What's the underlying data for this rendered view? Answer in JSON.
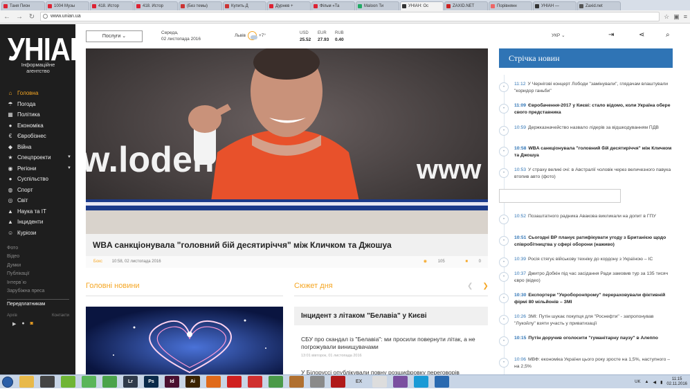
{
  "browser": {
    "tabs": [
      {
        "label": "Таня Пион",
        "color": "#d23"
      },
      {
        "label": "1004 Музы",
        "color": "#d23"
      },
      {
        "label": "418. Истор",
        "color": "#d23"
      },
      {
        "label": "418. Истор",
        "color": "#d23"
      },
      {
        "label": "(Без темы)",
        "color": "#c33"
      },
      {
        "label": "Купить Д",
        "color": "#c33"
      },
      {
        "label": "Дурнев +",
        "color": "#d23"
      },
      {
        "label": "Фільм «Та",
        "color": "#d23"
      },
      {
        "label": "Maloon Ти",
        "color": "#2a6"
      },
      {
        "label": "УНІАН: Ос",
        "color": "#333",
        "active": true
      },
      {
        "label": "ZAXID.NET",
        "color": "#c22"
      },
      {
        "label": "Порівнянн",
        "color": "#e66"
      },
      {
        "label": "УНІАН — ",
        "color": "#333"
      },
      {
        "label": "Zaxid.net",
        "color": "#555"
      }
    ],
    "url": "www.unian.ua"
  },
  "sidebar": {
    "logo": "УНІАН",
    "logo_sub1": "Інформаційне",
    "logo_sub2": "агентство",
    "menu": [
      {
        "label": "Головна",
        "icon": "home-icon",
        "glyph": "⌂",
        "active": true
      },
      {
        "label": "Погода",
        "icon": "umbrella-icon",
        "glyph": "☂"
      },
      {
        "label": "Політика",
        "icon": "building-icon",
        "glyph": "▦"
      },
      {
        "label": "Економіка",
        "icon": "coin-icon",
        "glyph": "●"
      },
      {
        "label": "Євробізнес",
        "icon": "euro-icon",
        "glyph": "€"
      },
      {
        "label": "Війна",
        "icon": "shield-icon",
        "glyph": "◆"
      },
      {
        "label": "Спецпроекти",
        "icon": "star-icon",
        "glyph": "★",
        "caret": true
      },
      {
        "label": "Регіони",
        "icon": "globe-icon",
        "glyph": "◉",
        "caret": true
      },
      {
        "label": "Суспільство",
        "icon": "people-icon",
        "glyph": "●"
      },
      {
        "label": "Спорт",
        "icon": "ball-icon",
        "glyph": "◍"
      },
      {
        "label": "Світ",
        "icon": "world-icon",
        "glyph": "◎"
      },
      {
        "label": "Наука та IT",
        "icon": "flask-icon",
        "glyph": "▲"
      },
      {
        "label": "Інциденти",
        "icon": "warning-icon",
        "glyph": "▲"
      },
      {
        "label": "Куріози",
        "icon": "smile-icon",
        "glyph": "☺"
      }
    ],
    "submenu": [
      "Фото",
      "Відео",
      "Думки",
      "Публікації",
      "Інтерв`ю",
      "Зарубіжна преса"
    ],
    "subscribers": "Передплатникам",
    "archive": "Архів",
    "contacts": "Контакти"
  },
  "topbar": {
    "services": "Послуги",
    "date_line1": "Середа,",
    "date_line2": "02 листопада 2016",
    "city": "Львів",
    "temp": "+7°",
    "currencies": [
      {
        "code": "USD",
        "value": "25.52"
      },
      {
        "code": "EUR",
        "value": "27.93"
      },
      {
        "code": "RUB",
        "value": "0.40"
      }
    ],
    "lang": "УКР"
  },
  "hero": {
    "title": "WBA санкціонувала \"головний бій десятиріччя\" між Кличком та Джошуа",
    "category": "Бокс",
    "datetime": "10:58, 02 листопада 2016",
    "views": "105",
    "comments": "0",
    "banner_text": "w.loden",
    "banner_text2": "www"
  },
  "sections": {
    "main_news": "Головні новини",
    "story": "Сюжет дня"
  },
  "story": {
    "title": "Інцидент з літаком \"Белавіа\" у Києві",
    "item1": "СБУ про скандал із \"Белавіа\": ми просили повернути літак, а не погрожували винищувачами",
    "item1_date": "13:01 вівторок, 01 листопада 2016",
    "item2": "У Білоруссі опублікували повну розшифровку переговорів"
  },
  "feed": {
    "title": "Стрічка новин",
    "items": [
      {
        "time": "11:12",
        "text": "У Чернігові концерт Лободи \"замінували\", глядачам влаштували \"коридор ганьби\"",
        "bold": false,
        "icon": "photo-icon"
      },
      {
        "time": "11:09",
        "text": "Євробачення-2017 у Києві: стало відомо, коли Україна обере свого представника",
        "bold": true,
        "icon": "news-icon"
      },
      {
        "time": "10:59",
        "text": "Держказначейство назвало лідерів за відшкодуванням ПДВ",
        "bold": false,
        "icon": "chart-icon"
      },
      {
        "time": "10:58",
        "text": "WBA санкціонувала \"головний бій десятиріччя\" між Кличком та Джошуа",
        "bold": true,
        "icon": "sport-icon"
      },
      {
        "time": "10:53",
        "text": "У страху великі очі: в Австралії чоловік через величезного павука втопив авто (фото)",
        "bold": false,
        "icon": "curio-icon"
      },
      {
        "time": "10:52",
        "text": "Позаштатного радника Авакова викликали на допит в ГПУ",
        "bold": false,
        "icon": "politics-icon"
      },
      {
        "time": "10:51",
        "text": "Сьогодні ВР планує ратифікувати угоду з Британією щодо співробітництва у сфері оборони (наживо)",
        "bold": true,
        "icon": "politics-icon"
      },
      {
        "time": "10:39",
        "text": "Росія стягує військову техніку до кордону з Україною – ІС",
        "bold": false,
        "icon": "war-icon"
      },
      {
        "time": "10:37",
        "text": "Дмитро Добкін під час засідання Ради замовив тур за 135 тисяч євро (відео)",
        "bold": false,
        "icon": "video-icon"
      },
      {
        "time": "10:30",
        "text": "Експортери \"Укроборонпрому\" перераховували фіктивній фірмі 80 мільйонів – ЗМІ",
        "bold": true,
        "icon": "incident-icon"
      },
      {
        "time": "10:26",
        "text": "ЗМІ: Путін шукає покупця для \"Роснефти\" - запропонував \"Лукойлу\" взяти участь у приватизації",
        "bold": false,
        "icon": "world-icon"
      },
      {
        "time": "10:15",
        "text": "Путін доручив оголосити \"гуманітарну паузу\" в Алеппо",
        "bold": true,
        "icon": "world-icon"
      },
      {
        "time": "10:06",
        "text": "МВФ: економіка України цього року зросте на 1,5%, наступного – на 2,5%",
        "bold": false,
        "icon": "economy-icon"
      }
    ]
  },
  "taskbar": {
    "apps": [
      {
        "name": "folder-app",
        "label": "",
        "color": "#e8b94a"
      },
      {
        "name": "media-app",
        "label": "",
        "color": "#444"
      },
      {
        "name": "evernote-app",
        "label": "",
        "color": "#6fb536"
      },
      {
        "name": "leaf-app",
        "label": "",
        "color": "#5ab55a"
      },
      {
        "name": "leaf2-app",
        "label": "",
        "color": "#4ba34b"
      },
      {
        "name": "lightroom-app",
        "label": "Lr",
        "color": "#2f3a4a"
      },
      {
        "name": "photoshop-app",
        "label": "Ps",
        "color": "#0a2a4a"
      },
      {
        "name": "indesign-app",
        "label": "Id",
        "color": "#4a1030"
      },
      {
        "name": "illustrator-app",
        "label": "Ai",
        "color": "#3a2200"
      },
      {
        "name": "firefox-app",
        "label": "",
        "color": "#e06a1a"
      },
      {
        "name": "red-app",
        "label": "",
        "color": "#d02020"
      },
      {
        "name": "red2-app",
        "label": "",
        "color": "#d03030"
      },
      {
        "name": "chrome-app",
        "label": "",
        "color": "#4a9a4a"
      },
      {
        "name": "photo-app",
        "label": "",
        "color": "#b07030"
      },
      {
        "name": "disc-app",
        "label": "",
        "color": "#8a8a8a"
      },
      {
        "name": "filezilla-app",
        "label": "",
        "color": "#b01a1a"
      },
      {
        "name": "ex-app",
        "label": "EX",
        "color": "#c8d5e6"
      },
      {
        "name": "doc-app",
        "label": "",
        "color": "#ddd"
      },
      {
        "name": "viber-app",
        "label": "",
        "color": "#7a4fa0"
      },
      {
        "name": "skype-app",
        "label": "",
        "color": "#1a9ad6"
      },
      {
        "name": "vlc-app",
        "label": "",
        "color": "#2a6ab0"
      },
      {
        "name": "word-app",
        "label": "",
        "color": "#c8d5e6"
      }
    ],
    "lang": "UK",
    "time": "11:15",
    "date": "02.11.2016"
  }
}
